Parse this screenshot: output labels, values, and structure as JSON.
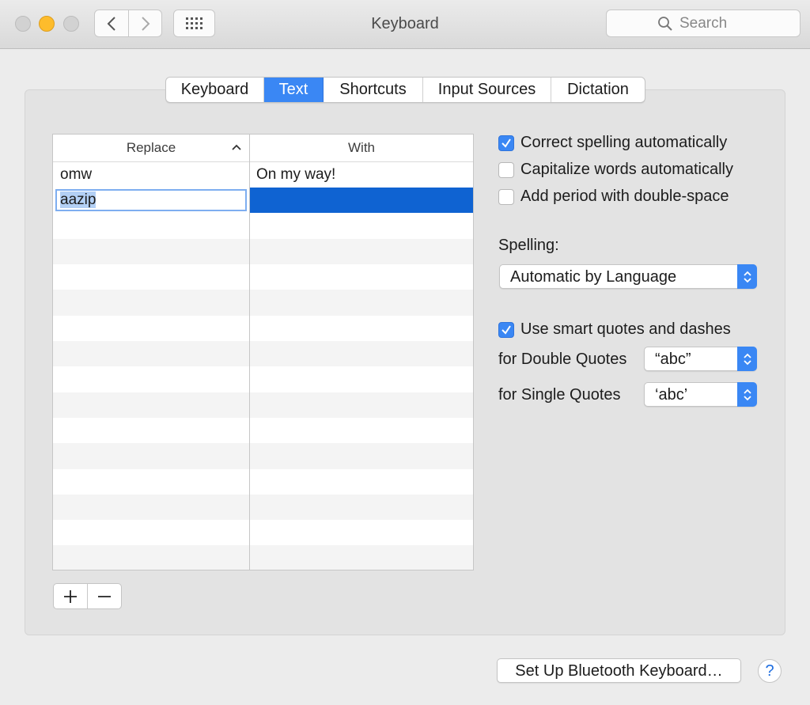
{
  "window": {
    "title": "Keyboard"
  },
  "search": {
    "placeholder": "Search"
  },
  "tabs": [
    {
      "label": "Keyboard",
      "active": false
    },
    {
      "label": "Text",
      "active": true
    },
    {
      "label": "Shortcuts",
      "active": false
    },
    {
      "label": "Input Sources",
      "active": false
    },
    {
      "label": "Dictation",
      "active": false
    }
  ],
  "table": {
    "headers": {
      "replace": "Replace",
      "with": "With"
    },
    "rows": [
      {
        "replace": "omw",
        "with": "On my way!"
      },
      {
        "replace": "aazip",
        "with": "",
        "editing": true,
        "selected": true
      }
    ]
  },
  "options": {
    "correct_spelling": {
      "label": "Correct spelling automatically",
      "checked": true
    },
    "capitalize_words": {
      "label": "Capitalize words automatically",
      "checked": false
    },
    "add_period": {
      "label": "Add period with double-space",
      "checked": false
    }
  },
  "spelling": {
    "label": "Spelling:",
    "value": "Automatic by Language"
  },
  "smart_quotes": {
    "label": "Use smart quotes and dashes",
    "checked": true,
    "double_label": "for Double Quotes",
    "double_value": "“abc”",
    "single_label": "for Single Quotes",
    "single_value": "‘abc’"
  },
  "bluetooth_button": {
    "label": "Set Up Bluetooth Keyboard…"
  },
  "help": {
    "label": "?"
  },
  "colors": {
    "accent": "#3a87f4",
    "selection": "#0f63d2",
    "minimize": "#fdbc2c"
  }
}
